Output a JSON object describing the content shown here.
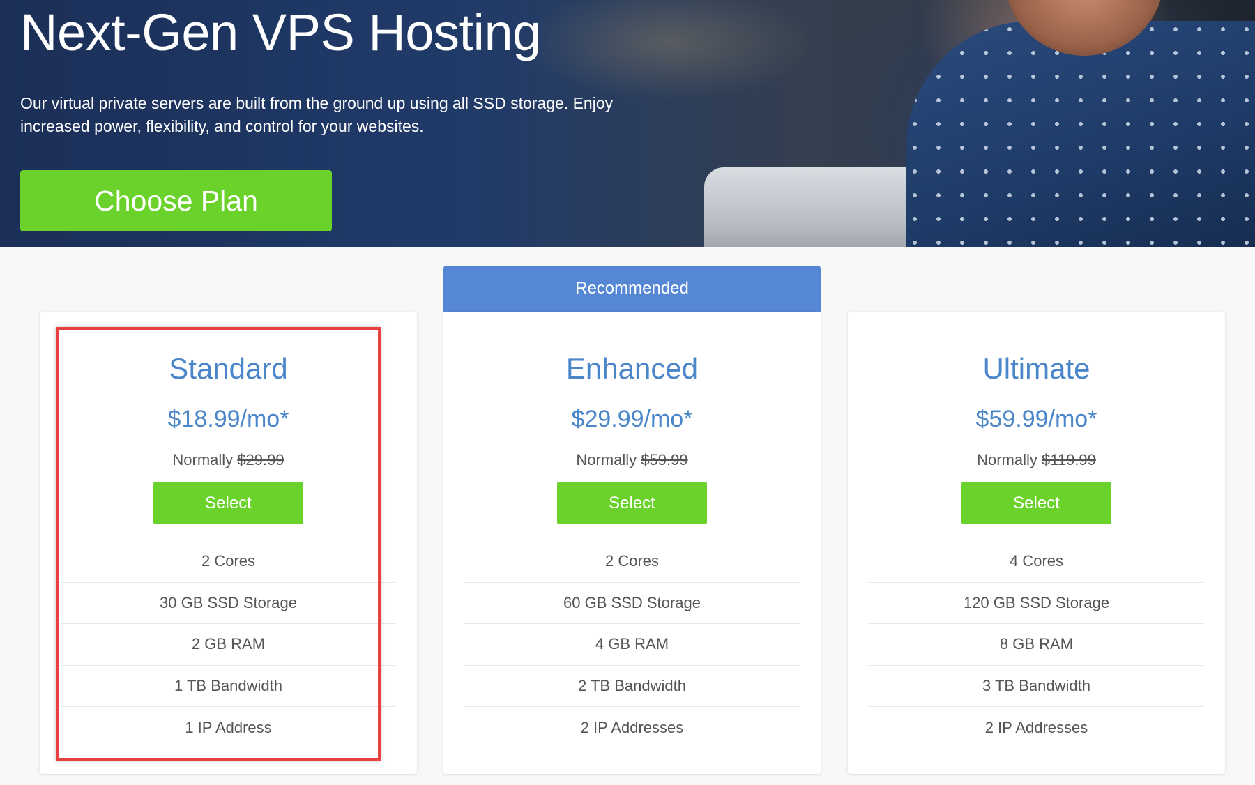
{
  "hero": {
    "title": "Next-Gen VPS Hosting",
    "description": "Our virtual private servers are built from the ground up using all SSD storage. Enjoy increased power, flexibility, and control for your websites.",
    "cta_label": "Choose Plan"
  },
  "recommended_label": "Recommended",
  "plans": [
    {
      "name": "Standard",
      "price": "$18.99/mo*",
      "normally_label": "Normally",
      "normal_price": "$29.99",
      "select_label": "Select",
      "features": [
        "2 Cores",
        "30 GB SSD Storage",
        "2 GB RAM",
        "1 TB Bandwidth",
        "1 IP Address"
      ]
    },
    {
      "name": "Enhanced",
      "price": "$29.99/mo*",
      "normally_label": "Normally",
      "normal_price": "$59.99",
      "select_label": "Select",
      "features": [
        "2 Cores",
        "60 GB SSD Storage",
        "4 GB RAM",
        "2 TB Bandwidth",
        "2 IP Addresses"
      ]
    },
    {
      "name": "Ultimate",
      "price": "$59.99/mo*",
      "normally_label": "Normally",
      "normal_price": "$119.99",
      "select_label": "Select",
      "features": [
        "4 Cores",
        "120 GB SSD Storage",
        "8 GB RAM",
        "3 TB Bandwidth",
        "2 IP Addresses"
      ]
    }
  ],
  "colors": {
    "hero_bg": "#1b2f58",
    "green_button": "#6bd12b",
    "recommended_bg": "#5587d4",
    "plan_text": "#4a86c9",
    "highlight": "#e8413f"
  }
}
